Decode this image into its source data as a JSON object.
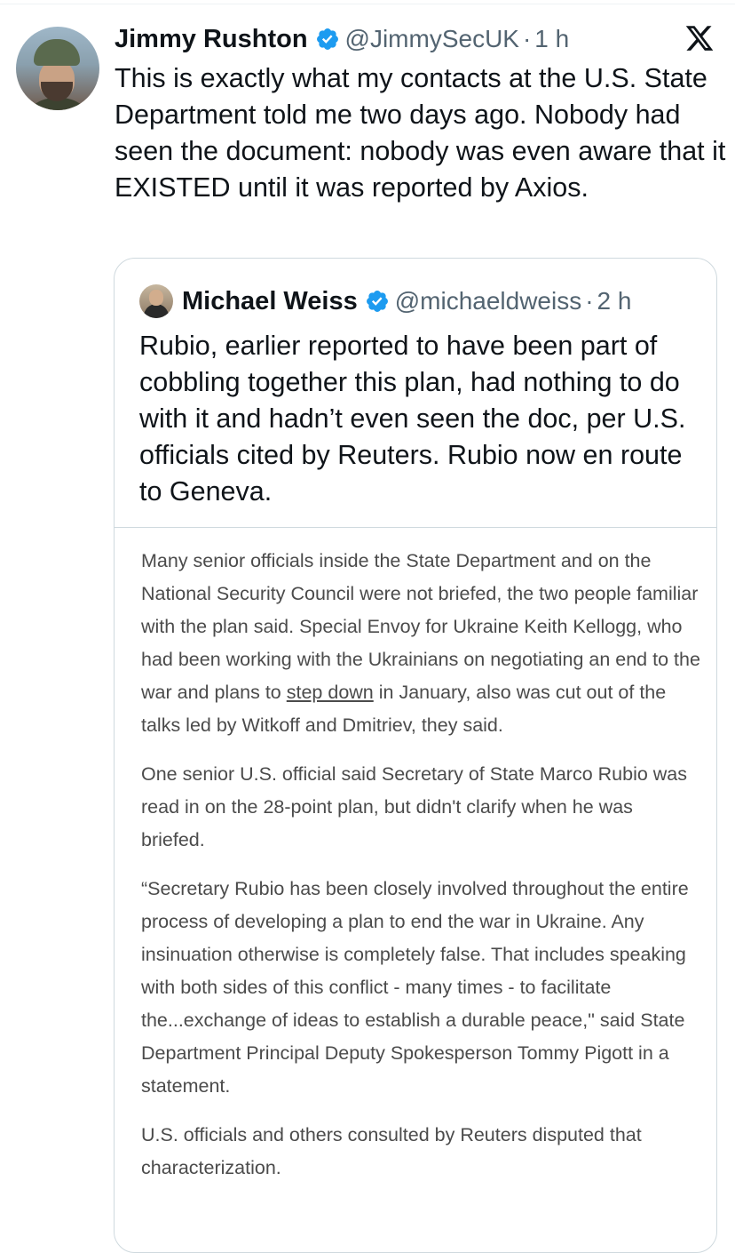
{
  "tweet": {
    "author_name": "Jimmy Rushton",
    "handle": "@JimmySecUK",
    "separator": "·",
    "time": "1 h",
    "text": "This is exactly what my contacts at the U.S. State Department told me two days ago. Nobody had seen the document: nobody was even aware that it EXISTED until it was reported by Axios.",
    "avatar_icon": "avatar-photo-icon",
    "verified_icon": "verified-badge-icon",
    "platform_logo": "x-logo-icon"
  },
  "quoted_tweet": {
    "author_name": "Michael Weiss",
    "handle": "@michaeldweiss",
    "separator": "·",
    "time": "2 h",
    "text": "Rubio, earlier reported to have been part of cobbling together this plan, had nothing to do with it and hadn’t even seen the doc, per U.S. officials cited by Reuters. Rubio now en route to Geneva.",
    "article_excerpt": {
      "p1_before": "Many senior officials inside the State Department and on the National Security Council were not briefed, the two people familiar with the plan said. Special Envoy for Ukraine Keith Kellogg, who had been working with the Ukrainians on negotiating an end to the war and plans to ",
      "p1_link": "step down",
      "p1_after": " in January, also was cut out of the talks led by Witkoff and Dmitriev, they said.",
      "p2": "One senior U.S. official said Secretary of State Marco Rubio was read in on the 28-point plan, but didn't clarify when he was briefed.",
      "p3": "“Secretary Rubio has been closely involved throughout the entire process of developing a plan to end the war in Ukraine. Any insinuation otherwise is completely false. That includes speaking with both sides of this conflict - many times - to facilitate the...exchange of ideas to establish a durable peace,\" said State Department Principal Deputy Spokesperson Tommy Pigott in a statement.",
      "p4": "U.S. officials and others consulted by Reuters disputed that characterization."
    }
  },
  "colors": {
    "text_primary": "#0f1419",
    "text_secondary": "#536471",
    "verified_blue": "#1d9bf0",
    "border": "#cfd9de",
    "excerpt_text": "#4b4b4b"
  }
}
